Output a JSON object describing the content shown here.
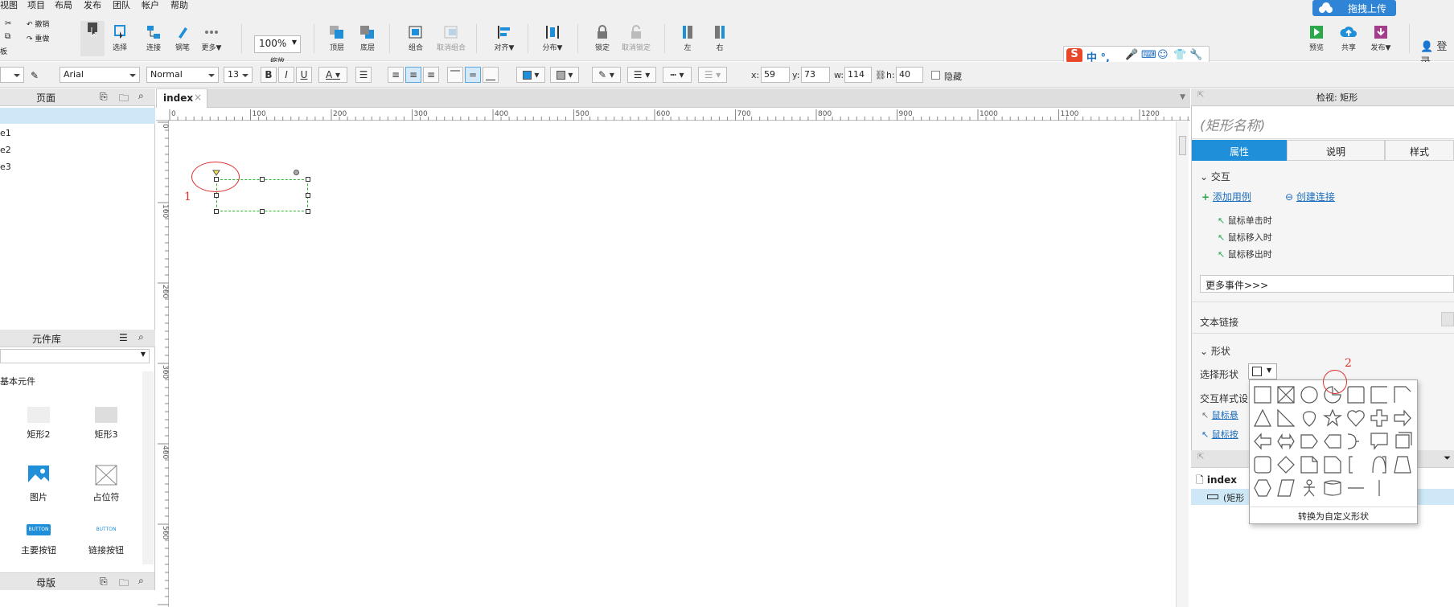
{
  "menubar": [
    "视图",
    "项目",
    "布局",
    "发布",
    "团队",
    "帐户",
    "帮助"
  ],
  "toolbar": {
    "undo": "撤销",
    "redo": "重做",
    "clipboard_label": "板",
    "select": "选择",
    "connect": "连接",
    "pen": "钢笔",
    "more": "更多▼",
    "zoom_value": "100%",
    "zoom_label": "缩放",
    "top": "顶层",
    "bottom": "底层",
    "group": "组合",
    "ungroup": "取消组合",
    "align": "对齐▼",
    "distribute": "分布▼",
    "lock": "锁定",
    "unlock": "取消锁定",
    "left": "左",
    "right": "右",
    "preview": "预览",
    "share": "共享",
    "publish": "发布▼",
    "upload": "拖拽上传",
    "login": "登录",
    "ime": "中 °,"
  },
  "format": {
    "font": "Arial",
    "style": "Normal",
    "size": "13",
    "bold": "B",
    "italic": "I",
    "underline": "U",
    "font_color": "A",
    "x_label": "x:",
    "x": "59",
    "y_label": "y:",
    "y": "73",
    "w_label": "w:",
    "w": "114",
    "h_label": "h:",
    "h": "40",
    "hidden": "隐藏"
  },
  "pages": {
    "title": "页面",
    "items": [
      "e1",
      "e2",
      "e3"
    ]
  },
  "library": {
    "title": "元件库",
    "group": "基本元件",
    "items": [
      {
        "label": "矩形2"
      },
      {
        "label": "矩形3"
      },
      {
        "label": "图片"
      },
      {
        "label": "占位符"
      },
      {
        "label": "主要按钮",
        "badge": "BUTTON"
      },
      {
        "label": "链接按钮",
        "badge": "BUTTON"
      }
    ]
  },
  "masters": {
    "title": "母版"
  },
  "canvas": {
    "tab": "index",
    "ruler_h": [
      "0",
      "100",
      "200",
      "300",
      "400",
      "500",
      "600",
      "700",
      "800",
      "900",
      "1000",
      "1100",
      "1200"
    ],
    "ruler_v": [
      "0",
      "100",
      "200",
      "300",
      "400",
      "500"
    ],
    "annotation_1": "1"
  },
  "inspector": {
    "title": "检视: 矩形",
    "name_placeholder": "(矩形名称)",
    "tabs": [
      "属性",
      "说明",
      "样式"
    ],
    "interaction_section": "交互",
    "add_case": "添加用例",
    "create_link": "创建连接",
    "events": [
      "鼠标单击时",
      "鼠标移入时",
      "鼠标移出时"
    ],
    "more_events": "更多事件>>>",
    "text_link": "文本链接",
    "shape_section": "形状",
    "select_shape": "选择形状",
    "interaction_style": "交互样式设",
    "hover_link": "鼠标悬",
    "press_link": "鼠标按",
    "annotation_2": "2"
  },
  "outline": {
    "page": "index",
    "item": "(矩形"
  },
  "shape_picker": {
    "convert": "转换为自定义形状"
  },
  "colors": {
    "accent": "#1e8fd8",
    "selection": "#2bb52b",
    "annotation": "#e03030"
  }
}
